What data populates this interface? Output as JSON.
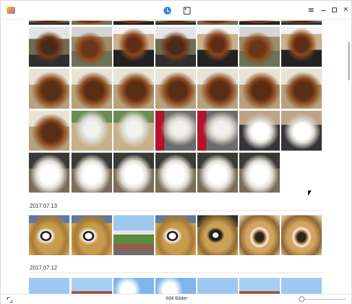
{
  "titlebar": {
    "views": [
      "timeline-view",
      "albums-view"
    ]
  },
  "sections": [
    {
      "date": "2017.07.13"
    },
    {
      "date": "2017.07.12"
    }
  ],
  "status": {
    "count_text": "694 Bilder",
    "zoom_level": 0
  },
  "colors": {
    "accent": "#2b88d8",
    "text": "#333333",
    "divider": "#e6e6e6"
  }
}
